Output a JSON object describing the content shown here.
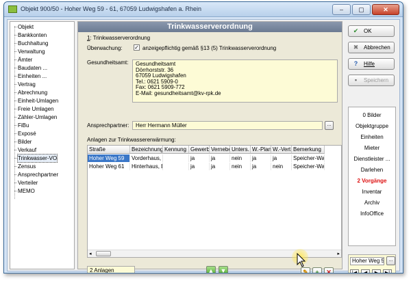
{
  "window": {
    "title": "Objekt 900/50 - Hoher Weg 59 - 61, 67059 Ludwigshafen a. Rhein",
    "min": "–",
    "max": "▢",
    "close": "✕"
  },
  "tree": {
    "items": [
      "Objekt",
      "Bankkonten",
      "Buchhaltung",
      "Verwaltung",
      "Ämter",
      "Baudaten ...",
      "Einheiten ...",
      "Vertrag",
      "Abrechnung",
      "Einheit-Umlagen",
      "Freie Umlagen",
      "Zähler-Umlagen",
      "FiBu",
      "Exposé",
      "Bilder",
      "Verkauf",
      "Trinkwasser-VO",
      "Zensus",
      "Ansprechpartner",
      "Verteiler",
      "MEMO"
    ],
    "selected_index": 16
  },
  "main": {
    "title": "Trinkwasserverordnung",
    "section_number": "1",
    "section_label": ": Trinkwasserverordnung",
    "ueberwachung_label": "Überwachung:",
    "ueberwachung_check": "✓",
    "ueberwachung_text": "anzeigepflichtig gemäß §13 (5) Trinkwasserverordnung",
    "gesundheitsamt_label": "Gesundheitsamt:",
    "gesundheitsamt_lines": [
      "Gesundheitsamt",
      "Dörrhorststr. 36",
      "67059 Ludwigshafen",
      "Tel.: 0621 5909-0",
      "Fax: 0621 5909-772",
      "E-Mail: gesundheitsamt@kv-rpk.de"
    ],
    "ansprechpartner_label": "Ansprechpartner:",
    "ansprechpartner_value": "Herr Hermann Müller",
    "ellipsis": "...",
    "anlagen_label": "Anlagen zur Trinkwassererwärmung:",
    "table": {
      "headers": [
        "Straße",
        "Bezeichnung",
        "Kennung",
        "Gewerbe",
        "Vernebel",
        "Unters.",
        "W.-Plan",
        "W.-Vert",
        "Bemerkung"
      ],
      "rows": [
        [
          "Hoher Weg 59",
          "Vorderhaus,",
          "",
          "ja",
          "ja",
          "nein",
          "ja",
          "ja",
          "Speicher-Was"
        ],
        [
          "Hoher Weg 61",
          "Hinterhaus, E",
          "",
          "ja",
          "ja",
          "nein",
          "ja",
          "nein",
          "Speicher-Was"
        ]
      ]
    },
    "count": "2 Anlagen"
  },
  "buttons": {
    "ok": "OK",
    "abbrechen": "Abbrechen",
    "hilfe": "Hilfe",
    "speichern": "Speichern"
  },
  "right_links": [
    "0 Bilder",
    "Objektgruppe",
    "Einheiten",
    "Mieter",
    "Dienstleister ...",
    "Darlehen",
    "2 Vorgänge",
    "Inventar",
    "Archiv",
    "InfoOffice"
  ],
  "nav": {
    "value": "Hoher Weg 59"
  },
  "colors": {
    "accent": "#3a77c8",
    "alert": "#dd1111",
    "form_bg": "#fdfbd6"
  }
}
